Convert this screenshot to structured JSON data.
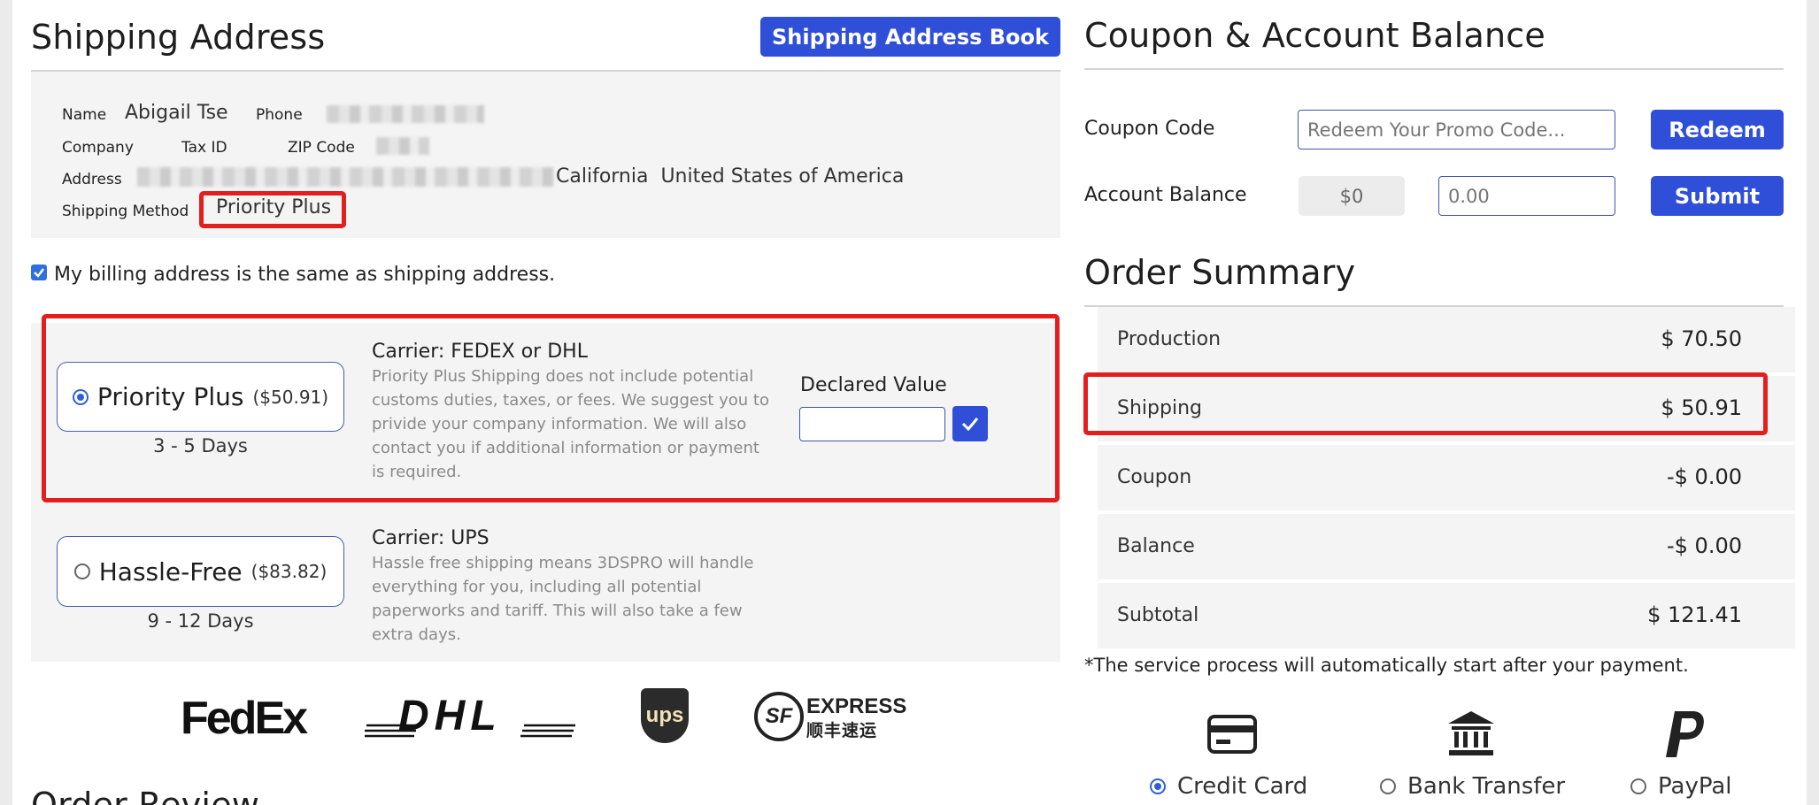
{
  "shipping": {
    "title": "Shipping Address",
    "address_book_button": "Shipping Address Book",
    "name_label": "Name",
    "name_value": "Abigail Tse",
    "phone_label": "Phone",
    "company_label": "Company",
    "tax_id_label": "Tax ID",
    "zip_label": "ZIP Code",
    "address_label": "Address",
    "address_visible": "California  United States of America",
    "method_label": "Shipping Method",
    "method_value": "Priority Plus",
    "billing_same_label": "My billing address is the same as shipping address.",
    "billing_same_checked": true
  },
  "options": [
    {
      "name": "Priority Plus",
      "price": "($50.91)",
      "days": "3 - 5 Days",
      "selected": true,
      "carrier": "Carrier: FEDEX or DHL",
      "description": "Priority Plus Shipping does not include potential customs duties, taxes, or fees. We suggest you to privide your company information. We will also contact you if additional information or payment is required.",
      "declared_label": "Declared Value"
    },
    {
      "name": "Hassle-Free",
      "price": "($83.82)",
      "days": "9 - 12 Days",
      "selected": false,
      "carrier": "Carrier: UPS",
      "description": "Hassle free shipping means 3DSPRO will handle everything for you, including all potential paperworks and tariff. This will also take a few extra days."
    }
  ],
  "logos": {
    "fedex": "FedEx",
    "dhl": "DHL",
    "ups": "ups",
    "sf_express": "EXPRESS",
    "sf_express_cn": "顺丰速运",
    "sf_mark": "SF"
  },
  "order_review_title": "Order Review",
  "coupon": {
    "title": "Coupon & Account Balance",
    "code_label": "Coupon Code",
    "code_placeholder": "Redeem Your Promo Code...",
    "redeem_button": "Redeem",
    "balance_label": "Account Balance",
    "balance_value": "$0",
    "balance_placeholder": "0.00",
    "submit_button": "Submit"
  },
  "summary": {
    "title": "Order Summary",
    "rows": [
      {
        "label": "Production",
        "value": "$ 70.50"
      },
      {
        "label": "Shipping",
        "value": "$ 50.91"
      },
      {
        "label": "Coupon",
        "value": "-$ 0.00"
      },
      {
        "label": "Balance",
        "value": "-$ 0.00"
      },
      {
        "label": "Subtotal",
        "value": "$ 121.41"
      }
    ],
    "note": "*The service process will automatically start after your payment."
  },
  "payment": {
    "methods": [
      {
        "label": "Credit Card",
        "icon": "credit-card-icon",
        "selected": true
      },
      {
        "label": "Bank Transfer",
        "icon": "bank-icon",
        "selected": false
      },
      {
        "label": "PayPal",
        "icon": "paypal-icon",
        "selected": false
      }
    ]
  },
  "colors": {
    "accent": "#2f4fd8",
    "highlight": "#e31e1e",
    "panel": "#f4f4f4"
  }
}
